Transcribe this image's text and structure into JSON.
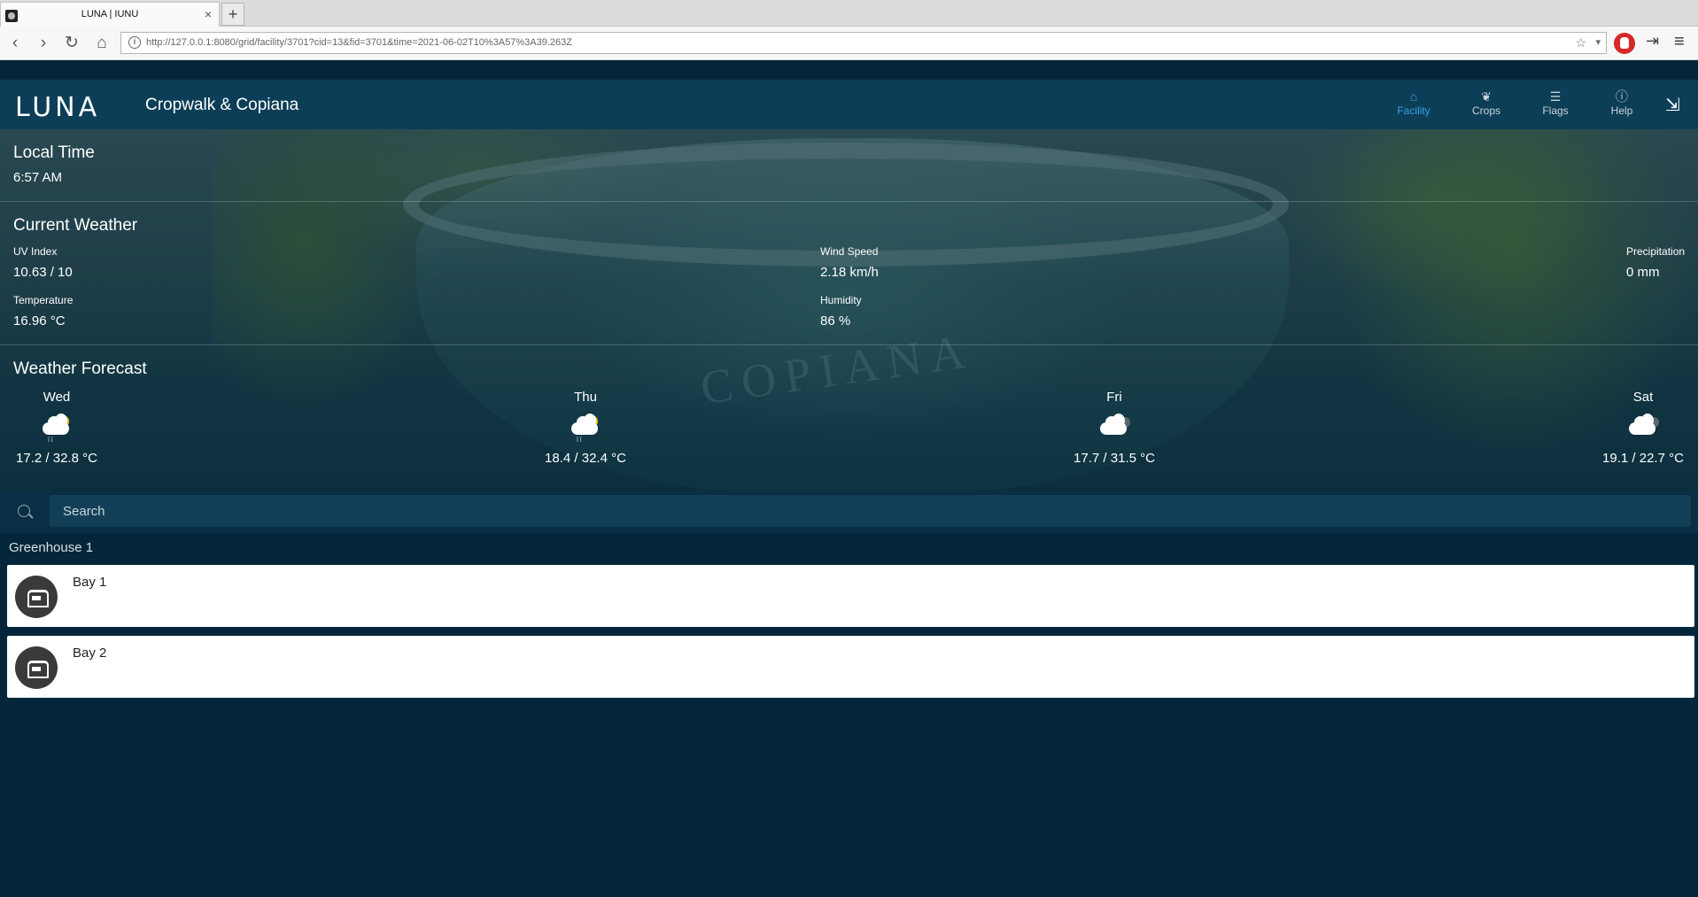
{
  "browser": {
    "tab_title": "LUNA | IUNU",
    "new_tab_label": "+",
    "tab_close": "×",
    "url": "http://127.0.0.1:8080/grid/facility/3701?cid=13&fid=3701&time=2021-06-02T10%3A57%3A39.263Z"
  },
  "app": {
    "logo": "LUNA",
    "facility_name": "Cropwalk & Copiana",
    "nav": [
      {
        "label": "Facility",
        "icon": "facility-icon"
      },
      {
        "label": "Crops",
        "icon": "crops-icon"
      },
      {
        "label": "Flags",
        "icon": "flags-icon"
      },
      {
        "label": "Help",
        "icon": "help-icon"
      }
    ],
    "active_color": "#3a9fe6"
  },
  "local_time": {
    "title": "Local Time",
    "value": "6:57 AM"
  },
  "current_weather": {
    "title": "Current Weather",
    "uv_label": "UV Index",
    "uv_value": "10.63 / 10",
    "wind_label": "Wind Speed",
    "wind_value": "2.18 km/h",
    "precip_label": "Precipitation",
    "precip_value": "0 mm",
    "temp_label": "Temperature",
    "temp_value": "16.96 °C",
    "humidity_label": "Humidity",
    "humidity_value": "86 %"
  },
  "forecast": {
    "title": "Weather Forecast",
    "days": [
      {
        "day": "Wed",
        "icon": "sun-cloud-rain-icon",
        "temp": "17.2 / 32.8 °C"
      },
      {
        "day": "Thu",
        "icon": "sun-cloud-rain-icon",
        "temp": "18.4 / 32.4 °C"
      },
      {
        "day": "Fri",
        "icon": "cloudy-icon",
        "temp": "17.7 / 31.5 °C"
      },
      {
        "day": "Sat",
        "icon": "cloudy-icon",
        "temp": "19.1 / 22.7 °C"
      }
    ]
  },
  "search": {
    "placeholder": "Search"
  },
  "greenhouse": {
    "title": "Greenhouse 1",
    "bays": [
      {
        "name": "Bay 1"
      },
      {
        "name": "Bay 2"
      }
    ]
  }
}
